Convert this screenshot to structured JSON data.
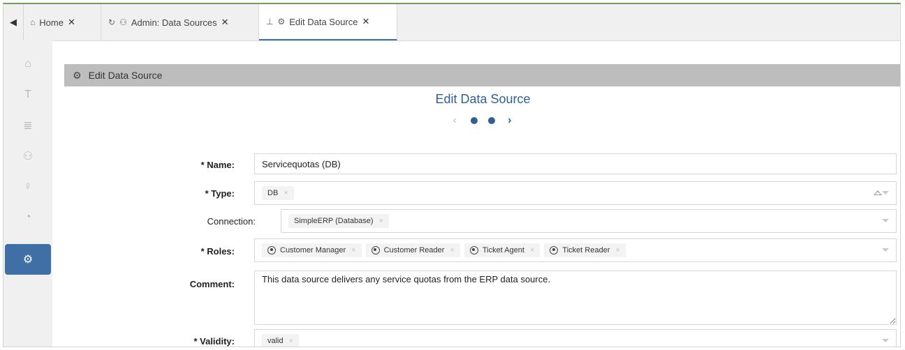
{
  "tabs": [
    {
      "label": "Home",
      "icon": "home-icon",
      "close": "✕"
    },
    {
      "label": "Admin: Data Sources",
      "icon": "refresh-users-icon",
      "close": "✕"
    },
    {
      "label": "Edit Data Source",
      "icon": "pin-gear-icon",
      "close": "✕",
      "active": true
    }
  ],
  "rail": {
    "items": [
      {
        "name": "home-icon"
      },
      {
        "name": "text-icon",
        "glyph": "T"
      },
      {
        "name": "database-icon"
      },
      {
        "name": "users-icon"
      },
      {
        "name": "lightbulb-icon"
      },
      {
        "name": "pie-chart-icon"
      },
      {
        "name": "users-gear-icon",
        "active": true
      }
    ]
  },
  "panel": {
    "header": "Edit Data Source"
  },
  "wizard": {
    "title": "Edit Data Source",
    "step": 2,
    "steps": 2
  },
  "form": {
    "name": {
      "label": "* Name:",
      "value": "Servicequotas (DB)"
    },
    "type": {
      "label": "* Type:",
      "chips": [
        "DB"
      ]
    },
    "connection": {
      "label": "Connection:",
      "chips": [
        "SimpleERP (Database)"
      ]
    },
    "roles": {
      "label": "* Roles:",
      "chips": [
        "Customer Manager",
        "Customer Reader",
        "Ticket Agent",
        "Ticket Reader"
      ]
    },
    "comment": {
      "label": "Comment:",
      "value": "This data source delivers any service quotas from the ERP data source."
    },
    "validity": {
      "label": "* Validity:",
      "chips": [
        "valid"
      ]
    }
  },
  "chip_remove_glyph": "×",
  "colors": {
    "accent": "#3f6fa5",
    "title": "#2f5f95",
    "header_bg": "#bdbdbd"
  }
}
